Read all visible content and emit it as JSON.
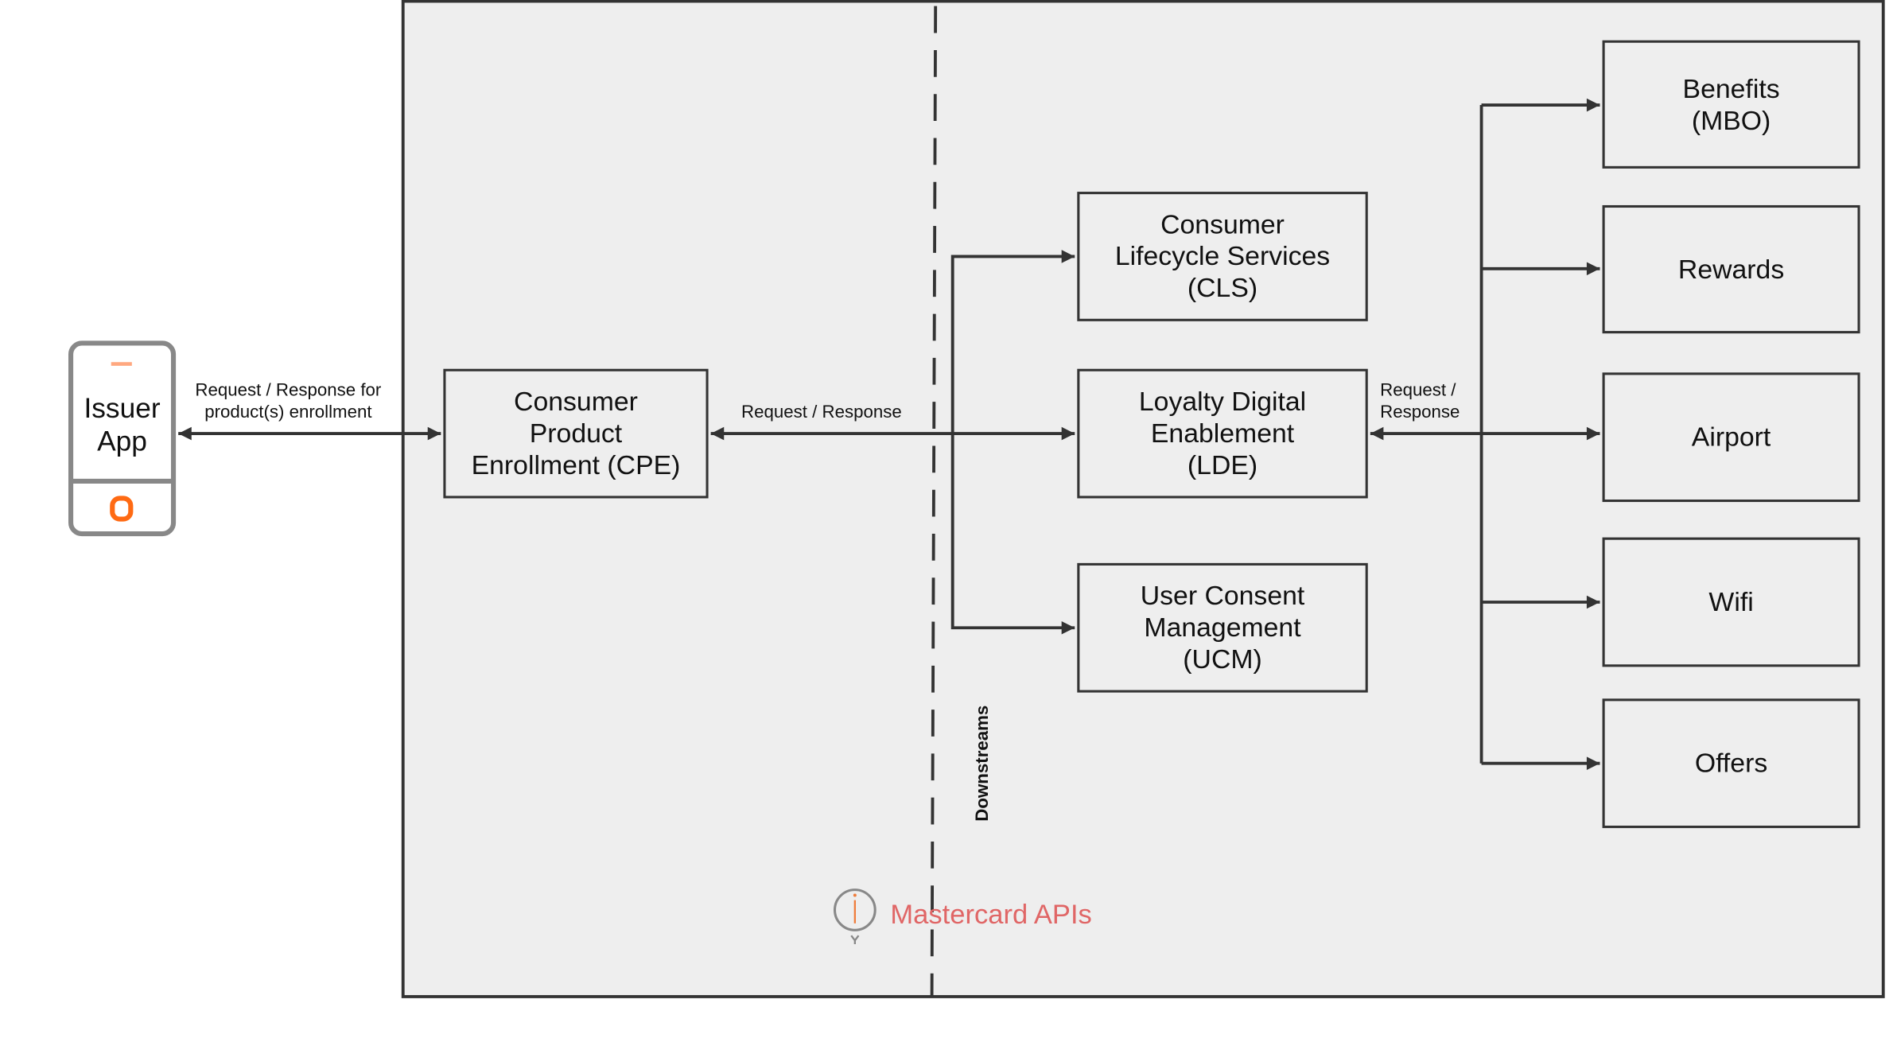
{
  "issuer_app": {
    "label": "Issuer\nApp",
    "icon": "mobile-phone-icon"
  },
  "edges": {
    "app_cpe": "Request / Response for\nproduct(s) enrollment",
    "cpe_lde": "Request / Response",
    "lde_downstreams": "Request /\nResponse"
  },
  "boxes": {
    "cpe": "Consumer\nProduct\nEnrollment (CPE)",
    "cls": "Consumer\nLifecycle Services\n(CLS)",
    "lde": "Loyalty Digital\nEnablement\n(LDE)",
    "ucm": "User Consent\nManagement\n(UCM)",
    "benefits": "Benefits\n(MBO)",
    "rewards": "Rewards",
    "airport": "Airport",
    "wifi": "Wifi",
    "offers": "Offers"
  },
  "downstreams_label": "Downstreams",
  "boundary": {
    "label": "Mastercard APIs",
    "icon": "info-pin-icon",
    "label_color": "#e06666"
  },
  "colors": {
    "frame_fill": "#eeeeee",
    "stroke": "#333333",
    "accent_orange": "#ff6a13"
  }
}
